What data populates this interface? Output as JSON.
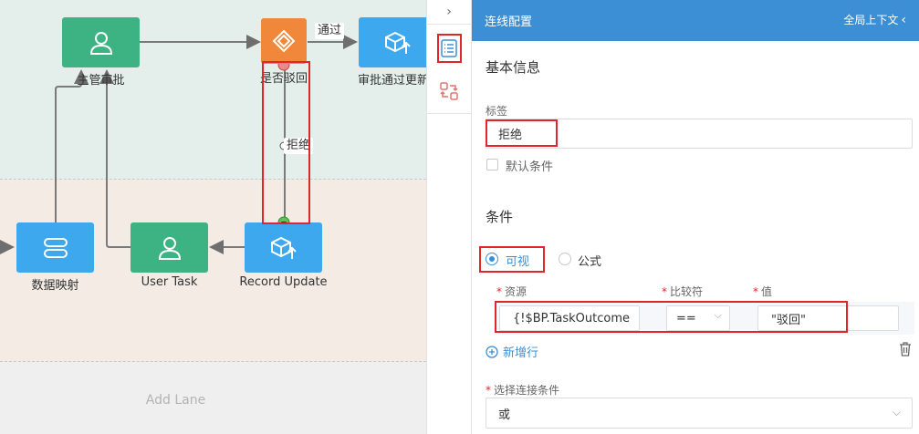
{
  "canvas": {
    "nodes": {
      "manager_approval": "主管审批",
      "reject_gateway": "是否驳回",
      "approved_update": "审批通过更新",
      "data_mapping": "数据映射",
      "user_task": "User Task",
      "record_update": "Record Update"
    },
    "edge_labels": {
      "pass": "通过",
      "reject": "拒绝"
    },
    "add_lane": "Add Lane"
  },
  "toolbar": {
    "collapse_icon": "chevron-right-icon",
    "properties_icon": "list-icon",
    "flow_icon": "swap-icon"
  },
  "panel": {
    "title": "连线配置",
    "global_context": "全局上下文",
    "basic_info": "基本信息",
    "label_field": {
      "label": "标签",
      "value": "拒绝"
    },
    "default_condition": "默认条件",
    "conditions": "条件",
    "mode_visual": "可视",
    "mode_formula": "公式",
    "columns": {
      "resource": "资源",
      "operator": "比较符",
      "value": "值"
    },
    "row": {
      "resource": "{!$BP.TaskOutcome",
      "operator": "==",
      "value": "\"驳回\""
    },
    "add_row": "新增行",
    "connect_label": "选择连接条件",
    "connect_value": "或"
  },
  "colors": {
    "header": "#3c8fd5",
    "green_node": "#3db383",
    "blue_node": "#3ea8ef",
    "orange_node": "#f0873a",
    "highlight": "#e0252b"
  }
}
